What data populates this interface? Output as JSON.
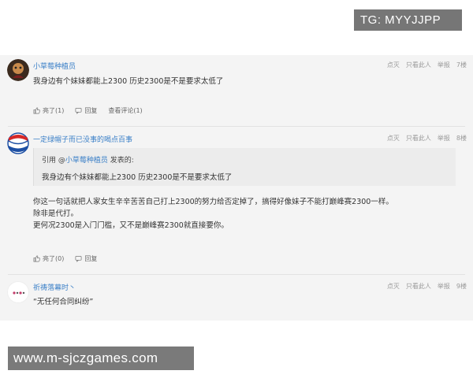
{
  "watermark_top": "TG: MYYJJPP",
  "watermark_bottom": "www.m-sjczgames.com",
  "meta_links": {
    "dian_zan": "点灭",
    "only_this": "只看此人",
    "report": "举报"
  },
  "posts": [
    {
      "username": "小草莓种植员",
      "floor": "7楼",
      "content": "我身边有个妹妹都能上2300 历史2300是不是要求太低了",
      "actions": {
        "like": "亮了(1)",
        "reply": "回复",
        "view_comments": "查看评论(1)"
      }
    },
    {
      "username": "一定绿帽子而已没事的喝点百事",
      "floor": "8楼",
      "quote": {
        "prefix": "引用 @",
        "user": "小草莓种植员",
        "suffix": " 发表的:",
        "text": "我身边有个妹妹都能上2300 历史2300是不是要求太低了"
      },
      "content_lines": [
        "你这一句话就把人家女生辛辛苦苦自己打上2300的努力给否定掉了，搞得好像妹子不能打巅峰赛2300一样。",
        "除非是代打。",
        "更何况2300是入门门槛，又不是巅峰赛2300就直接要你。"
      ],
      "actions": {
        "like": "亮了(0)",
        "reply": "回复"
      }
    },
    {
      "username": "祈祷落幕时丶",
      "floor": "9楼",
      "content": "“无任何合同纠纷”"
    }
  ]
}
